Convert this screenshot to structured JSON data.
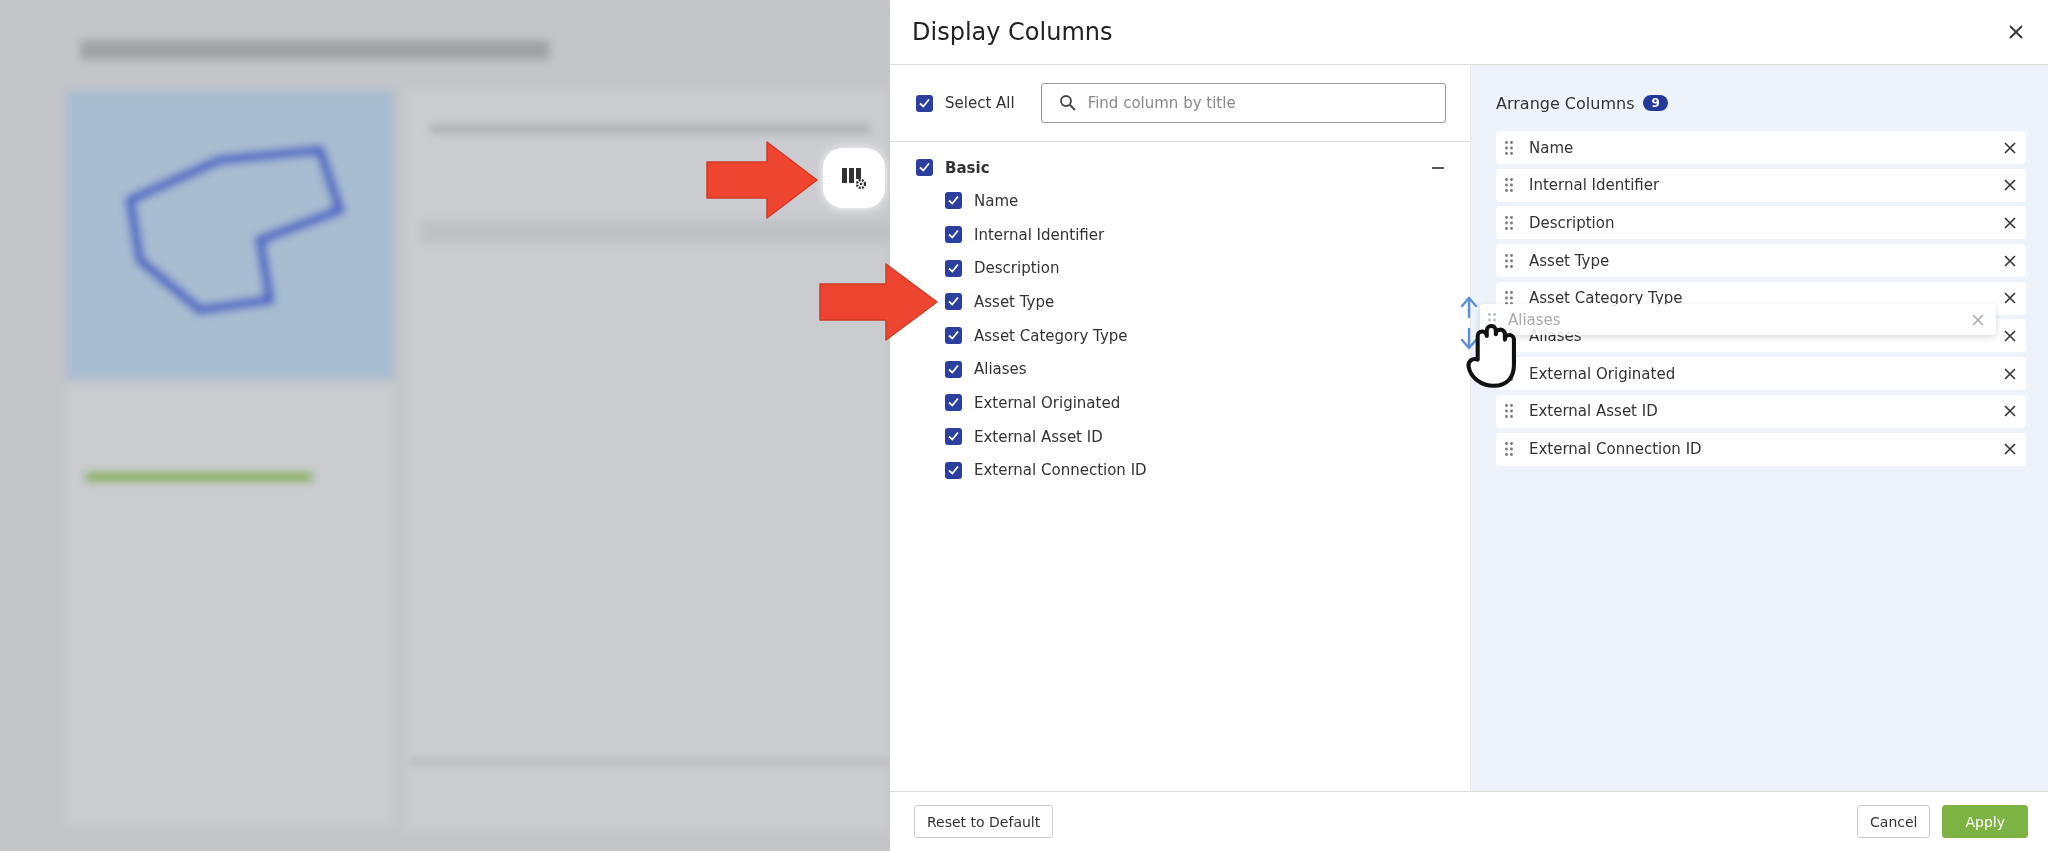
{
  "dialog": {
    "title": "Display Columns"
  },
  "select_all": {
    "label": "Select All",
    "checked": true
  },
  "search": {
    "placeholder": "Find column by title"
  },
  "group": {
    "label": "Basic",
    "checked": true,
    "expanded": true,
    "items": [
      {
        "label": "Name",
        "checked": true
      },
      {
        "label": "Internal Identifier",
        "checked": true
      },
      {
        "label": "Description",
        "checked": true
      },
      {
        "label": "Asset Type",
        "checked": true
      },
      {
        "label": "Asset Category Type",
        "checked": true
      },
      {
        "label": "Aliases",
        "checked": true
      },
      {
        "label": "External Originated",
        "checked": true
      },
      {
        "label": "External Asset ID",
        "checked": true
      },
      {
        "label": "External Connection ID",
        "checked": true
      }
    ]
  },
  "arrange": {
    "title": "Arrange Columns",
    "count": "9",
    "items": [
      "Name",
      "Internal Identifier",
      "Description",
      "Asset Type",
      "Asset Category Type",
      "Aliases",
      "External Originated",
      "External Asset ID",
      "External Connection ID"
    ]
  },
  "dragged_item": {
    "label": "Aliases"
  },
  "footer": {
    "reset": "Reset to Default",
    "cancel": "Cancel",
    "apply": "Apply"
  }
}
